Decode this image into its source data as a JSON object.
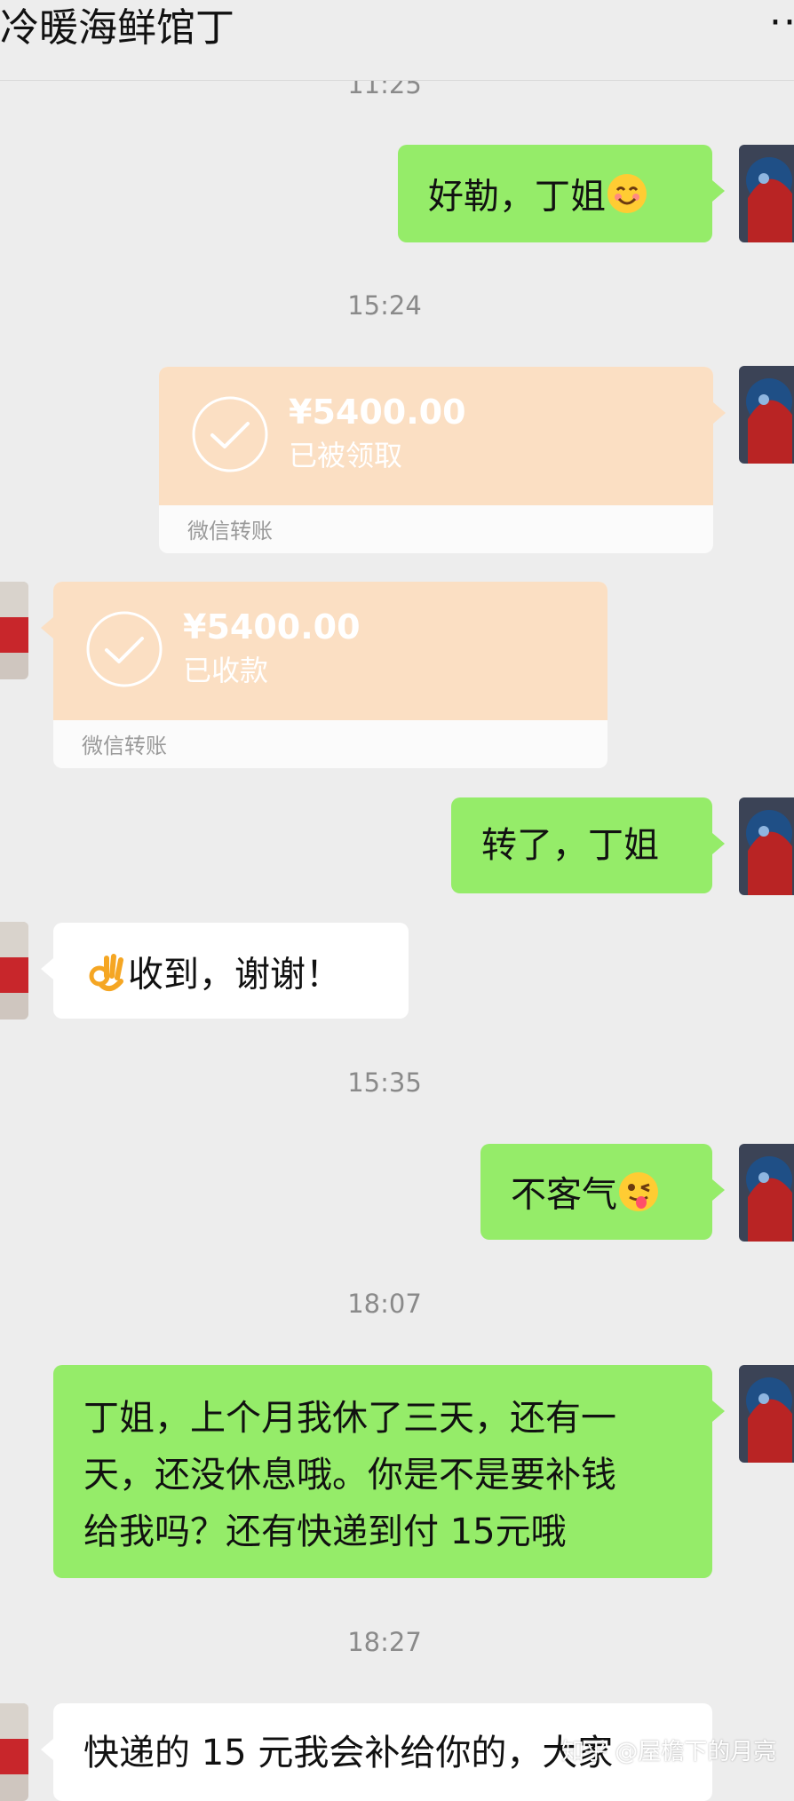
{
  "header": {
    "title": "冷暖海鲜馆丁",
    "more_glyph": "··"
  },
  "timestamps": [
    "11:25",
    "15:24",
    "15:35",
    "18:07",
    "18:27"
  ],
  "messages": {
    "m1": "好勒，丁姐",
    "m2": "转了，丁姐",
    "m3": "收到，谢谢！",
    "m4": "不客气",
    "m5_lines": [
      "丁姐，上个月我休了三天，还有一",
      "天，还没休息哦。你是不是要补钱",
      "给我吗？还有快递到付 15元哦"
    ],
    "m6": "快递的 15 元我会补给你的，大家"
  },
  "transfers": [
    {
      "amount": "¥5400.00",
      "status": "已被领取",
      "label": "微信转账"
    },
    {
      "amount": "¥5400.00",
      "status": "已收款",
      "label": "微信转账"
    }
  ],
  "icons": {
    "m1_emoji": "smiling-face-icon",
    "m3_emoji": "ok-hand-icon",
    "m4_emoji": "winking-tongue-face-icon",
    "transfer_icon": "check-circle-icon"
  },
  "colors": {
    "bubble_green": "#95ec69",
    "transfer_card": "#fbdfc3",
    "background": "#ededed"
  },
  "watermark": "知乎 @屋檐下的月亮"
}
